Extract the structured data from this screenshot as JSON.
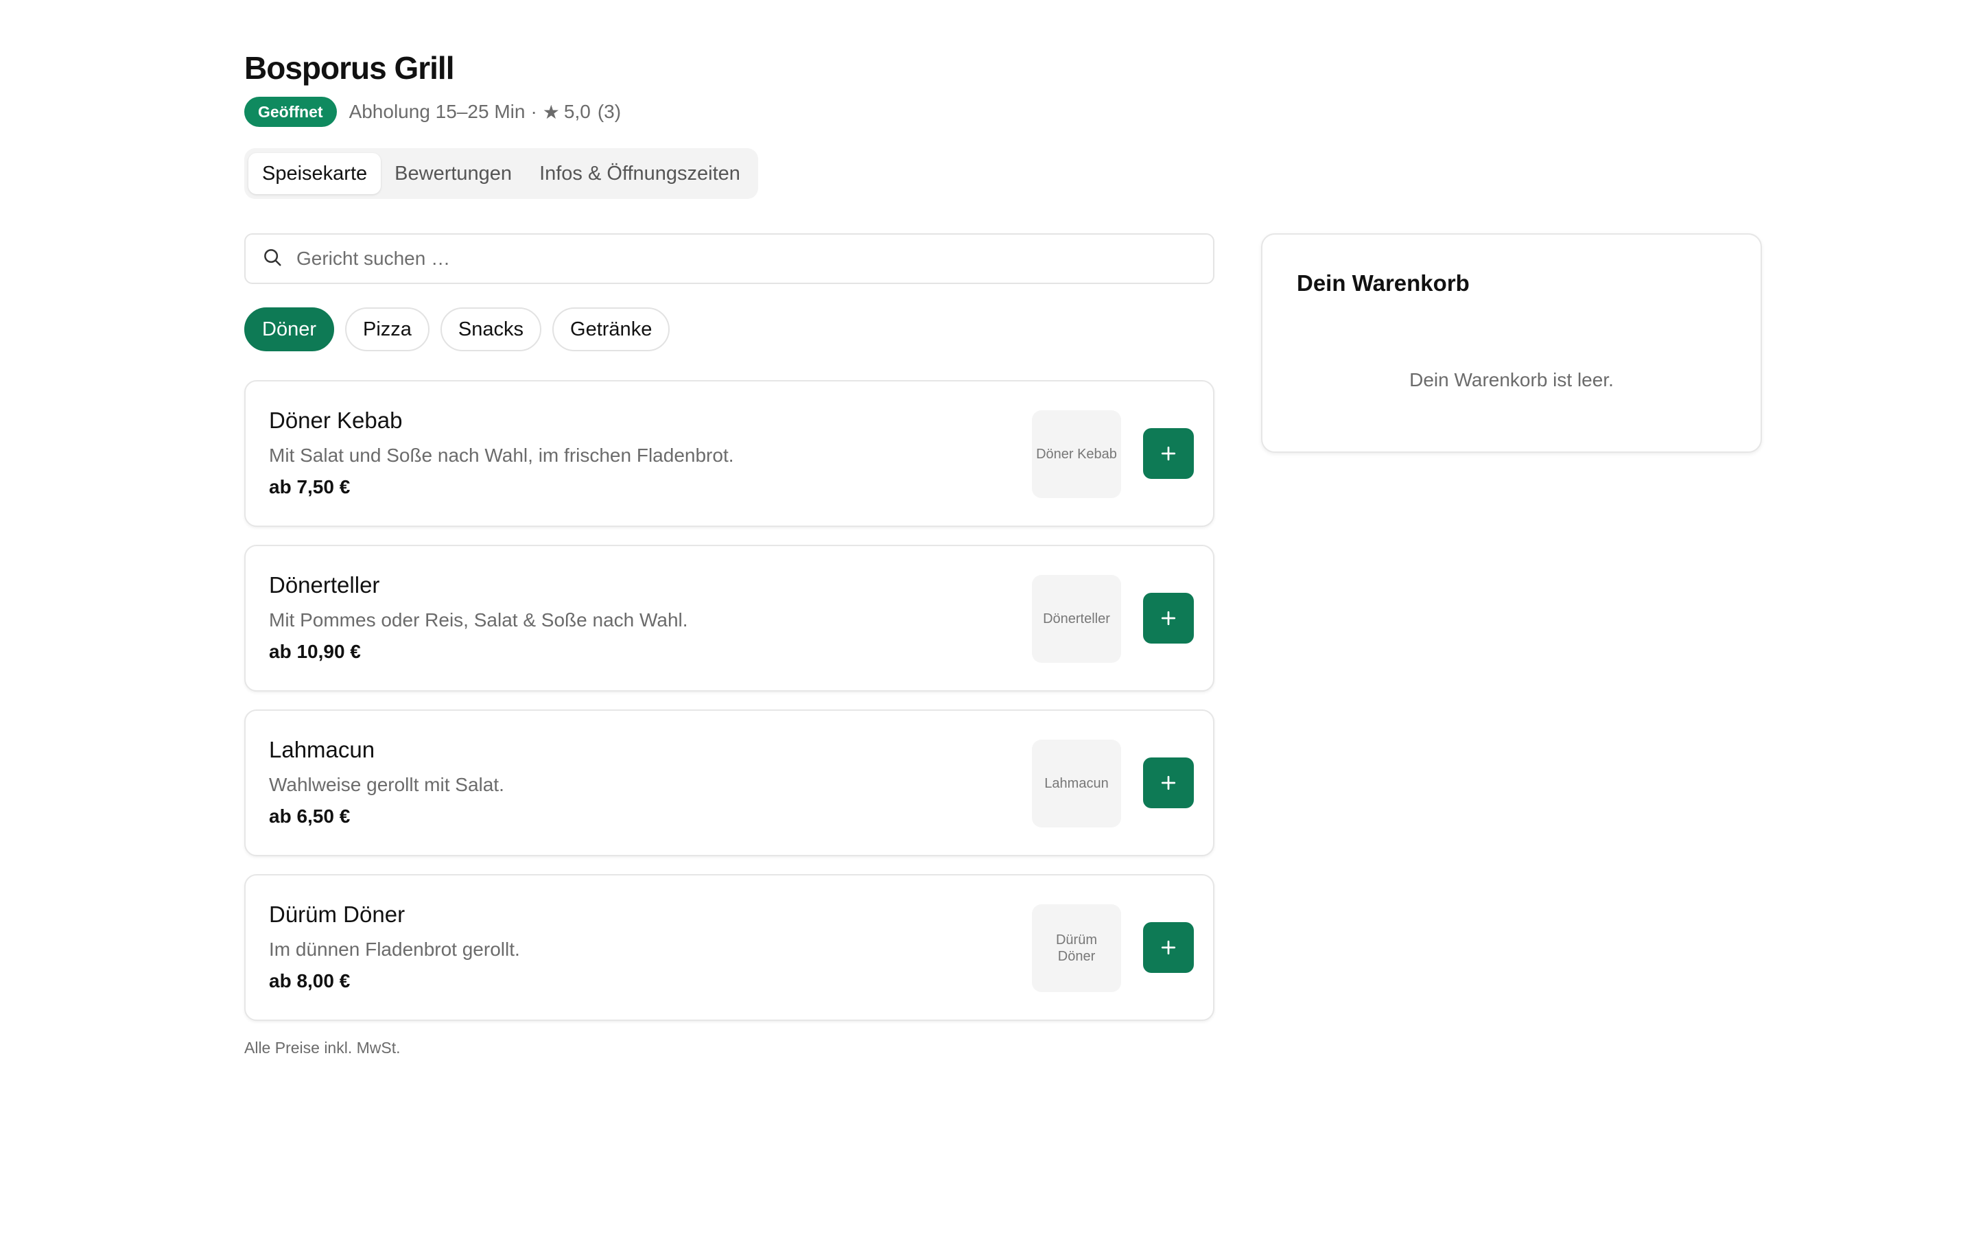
{
  "restaurant": {
    "name": "Bosporus Grill",
    "status_badge": "Geöffnet",
    "pickup": "Abholung 15–25 Min",
    "separator": "·",
    "rating": "5,0",
    "rating_count": "(3)"
  },
  "tabs": [
    {
      "label": "Speisekarte",
      "active": true
    },
    {
      "label": "Bewertungen",
      "active": false
    },
    {
      "label": "Infos & Öffnungszeiten",
      "active": false
    }
  ],
  "search": {
    "placeholder": "Gericht suchen …",
    "value": ""
  },
  "categories": [
    {
      "label": "Döner",
      "active": true
    },
    {
      "label": "Pizza",
      "active": false
    },
    {
      "label": "Snacks",
      "active": false
    },
    {
      "label": "Getränke",
      "active": false
    }
  ],
  "items": [
    {
      "name": "Döner Kebab",
      "description": "Mit Salat und Soße nach Wahl, im frischen Fladenbrot.",
      "price": "ab 7,50 €",
      "thumb_label": "Döner Kebab"
    },
    {
      "name": "Dönerteller",
      "description": "Mit Pommes oder Reis, Salat & Soße nach Wahl.",
      "price": "ab 10,90 €",
      "thumb_label": "Dönerteller"
    },
    {
      "name": "Lahmacun",
      "description": "Wahlweise gerollt mit Salat.",
      "price": "ab 6,50 €",
      "thumb_label": "Lahmacun"
    },
    {
      "name": "Dürüm Döner",
      "description": "Im dünnen Fladenbrot gerollt.",
      "price": "ab 8,00 €",
      "thumb_label": "Dürüm Döner"
    }
  ],
  "footnote": "Alle Preise inkl. MwSt.",
  "cart": {
    "title": "Dein Warenkorb",
    "empty_text": "Dein Warenkorb ist leer."
  },
  "icons": {
    "search": "search-icon",
    "add": "plus-icon",
    "rating": "star-icon"
  },
  "colors": {
    "accent": "#0e7a55",
    "badge": "#0f8a5f",
    "muted_text": "#6b6b6b",
    "tab_bar_bg": "#f3f3f3"
  }
}
